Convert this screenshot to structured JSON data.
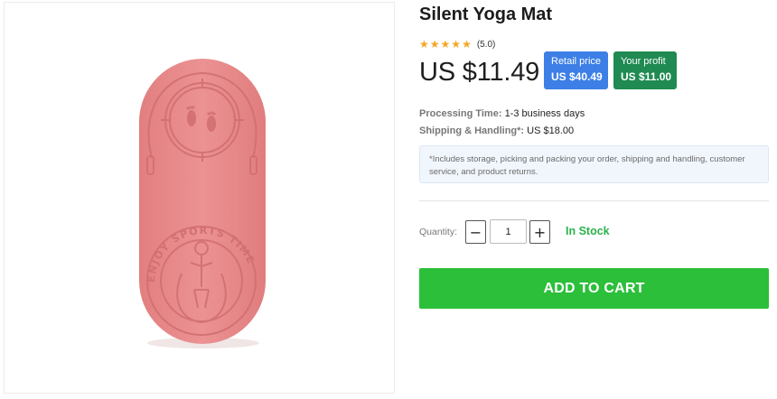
{
  "product": {
    "title": "Silent Yoga Mat",
    "rating_score": "(5.0)",
    "rating_value": 5,
    "rating_max": 5,
    "price": "US $11.49",
    "image_alt": "Silent Yoga Mat product image",
    "image_text": "ENJOY SPORTS TIME"
  },
  "badges": {
    "retail_label": "Retail price",
    "retail_value": "US $40.49",
    "profit_label": "Your profit",
    "profit_value": "US $11.00"
  },
  "info": {
    "processing_label": "Processing Time:",
    "processing_value": "1-3 business days",
    "shipping_label": "Shipping & Handling*:",
    "shipping_value": "US $18.00"
  },
  "note": "*Includes storage, picking and packing your order, shipping and handling, customer service, and product returns.",
  "quantity": {
    "label": "Quantity:",
    "minus": "−",
    "plus": "+",
    "value": "1"
  },
  "stock_status": "In Stock",
  "cart_button": "ADD TO CART",
  "colors": {
    "star": "#f5a623",
    "retail_badge": "#3d7fe6",
    "profit_badge": "#1f8a52",
    "in_stock": "#2bb24c",
    "cart_button": "#2cbf3a",
    "mat": "#e8898a"
  },
  "icons": [
    "star-icon",
    "minus-icon",
    "plus-icon"
  ]
}
